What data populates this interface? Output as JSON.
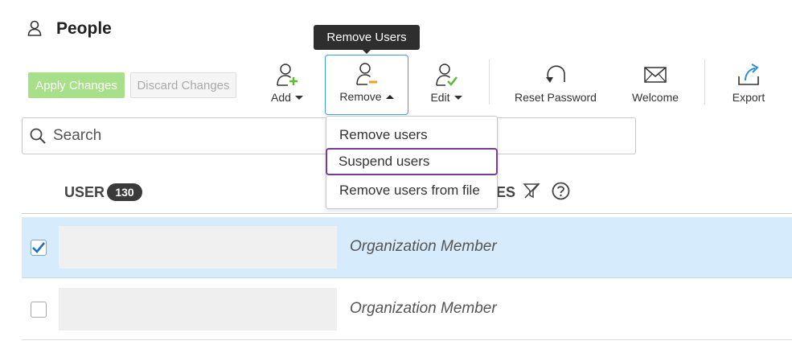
{
  "header": {
    "title": "People",
    "icon": "person-icon"
  },
  "actions": {
    "apply_label": "Apply Changes",
    "discard_label": "Discard Changes",
    "apply_color": "#a8e08a"
  },
  "toolbar": {
    "add": {
      "label": "Add",
      "icon": "user-add-icon"
    },
    "remove": {
      "label": "Remove",
      "icon": "user-remove-icon"
    },
    "edit": {
      "label": "Edit",
      "icon": "user-edit-icon"
    },
    "reset_password": {
      "label": "Reset Password",
      "icon": "undo-arrow-icon"
    },
    "welcome": {
      "label": "Welcome",
      "icon": "envelope-icon"
    },
    "export": {
      "label": "Export",
      "icon": "export-icon"
    }
  },
  "tooltip": {
    "text": "Remove Users"
  },
  "remove_menu": {
    "items": [
      {
        "label": "Remove users"
      },
      {
        "label": "Suspend users"
      },
      {
        "label": "Remove users from file"
      }
    ]
  },
  "search": {
    "placeholder": "Search"
  },
  "table": {
    "user_column": "USER",
    "user_count": "130",
    "roles_column_visible": "ES",
    "rows": [
      {
        "role": "Organization Member",
        "checked": true
      },
      {
        "role": "Organization Member",
        "checked": false
      }
    ]
  },
  "colors": {
    "accent": "#3aa0e0",
    "selected_row": "#d6ebfb",
    "highlight_outline": "#7b3a9b",
    "add_green": "#5dbb2f",
    "remove_orange": "#f0a020",
    "export_blue": "#2a8ee0"
  }
}
